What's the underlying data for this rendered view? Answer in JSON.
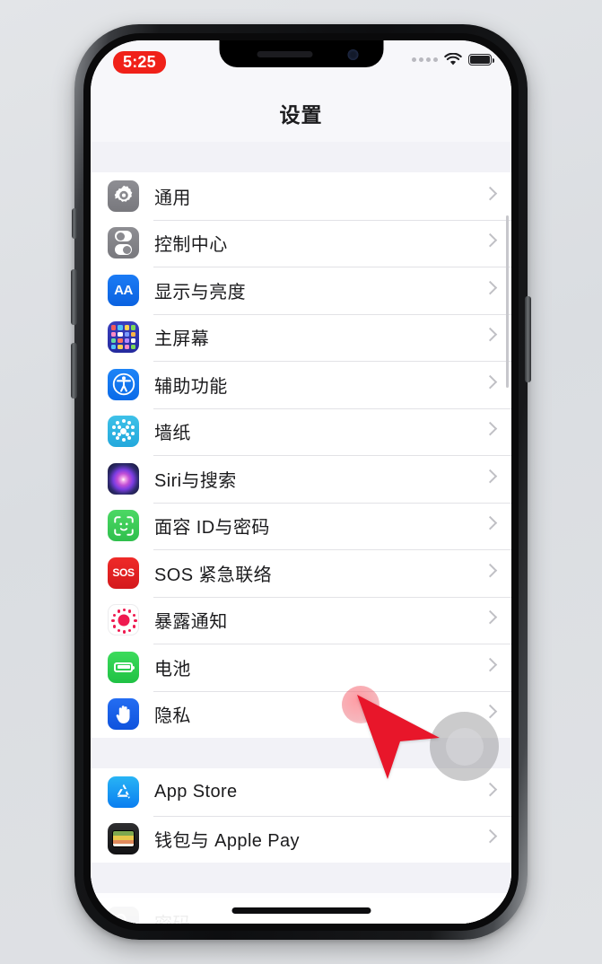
{
  "device": {
    "type": "iphone",
    "frame_color": "#0d0e10",
    "background_color": "#dfe2e5"
  },
  "status_bar": {
    "time": "5:25",
    "time_pill_color": "#f02119",
    "recording_active": true,
    "signal_dots": 4,
    "wifi_icon": "wifi-icon",
    "battery_icon": "battery-icon"
  },
  "nav": {
    "title": "设置"
  },
  "groups": [
    {
      "rows": [
        {
          "label": "通用",
          "icon": "gear-icon",
          "icon_class": "ic-general",
          "art": "gear"
        },
        {
          "label": "控制中心",
          "icon": "control-center-icon",
          "icon_class": "ic-control",
          "art": "toggles"
        },
        {
          "label": "显示与亮度",
          "icon": "display-aa-icon",
          "icon_class": "ic-display",
          "art": "aa",
          "glyph": "AA"
        },
        {
          "label": "主屏幕",
          "icon": "home-screen-icon",
          "icon_class": "ic-home",
          "art": "grid"
        },
        {
          "label": "辅助功能",
          "icon": "accessibility-icon",
          "icon_class": "ic-access",
          "art": "accessibility"
        },
        {
          "label": "墙纸",
          "icon": "wallpaper-icon",
          "icon_class": "ic-wallpaper",
          "art": "wallpaper"
        },
        {
          "label": "Siri与搜索",
          "icon": "siri-icon",
          "icon_class": "ic-siri",
          "art": "siri"
        },
        {
          "label": "面容 ID与密码",
          "icon": "face-id-icon",
          "icon_class": "ic-faceid",
          "art": "faceid"
        },
        {
          "label": "SOS 紧急联络",
          "icon": "sos-icon",
          "icon_class": "ic-sos",
          "art": "sos",
          "glyph": "SOS"
        },
        {
          "label": "暴露通知",
          "icon": "exposure-notification-icon",
          "icon_class": "ic-exposure",
          "art": "exposure"
        },
        {
          "label": "电池",
          "icon": "battery-settings-icon",
          "icon_class": "ic-battery",
          "art": "battery"
        },
        {
          "label": "隐私",
          "icon": "privacy-hand-icon",
          "icon_class": "ic-privacy",
          "art": "hand"
        }
      ]
    },
    {
      "rows": [
        {
          "label": "App Store",
          "icon": "app-store-icon",
          "icon_class": "ic-appstore",
          "art": "appstore"
        },
        {
          "label": "钱包与 Apple Pay",
          "icon": "wallet-icon",
          "icon_class": "ic-wallet",
          "art": "wallet"
        }
      ]
    },
    {
      "partial": true,
      "rows": [
        {
          "label": "密码",
          "icon": "passwords-key-icon",
          "icon_class": "ic-passwords",
          "art": "key"
        }
      ]
    }
  ],
  "overlays": {
    "cursor": {
      "name": "mouse-cursor-arrow",
      "color": "#e8162a"
    },
    "tap_indicator": {
      "name": "tap-highlight",
      "color": "#e84655"
    },
    "assistive_touch": {
      "name": "assistive-touch-button",
      "color": "#828286"
    }
  },
  "colors": {
    "list_background": "#f2f2f7",
    "row_background": "#ffffff",
    "separator": "#e2e2e6",
    "chevron": "#c0c0c5",
    "label_text": "#1b1b1d"
  }
}
